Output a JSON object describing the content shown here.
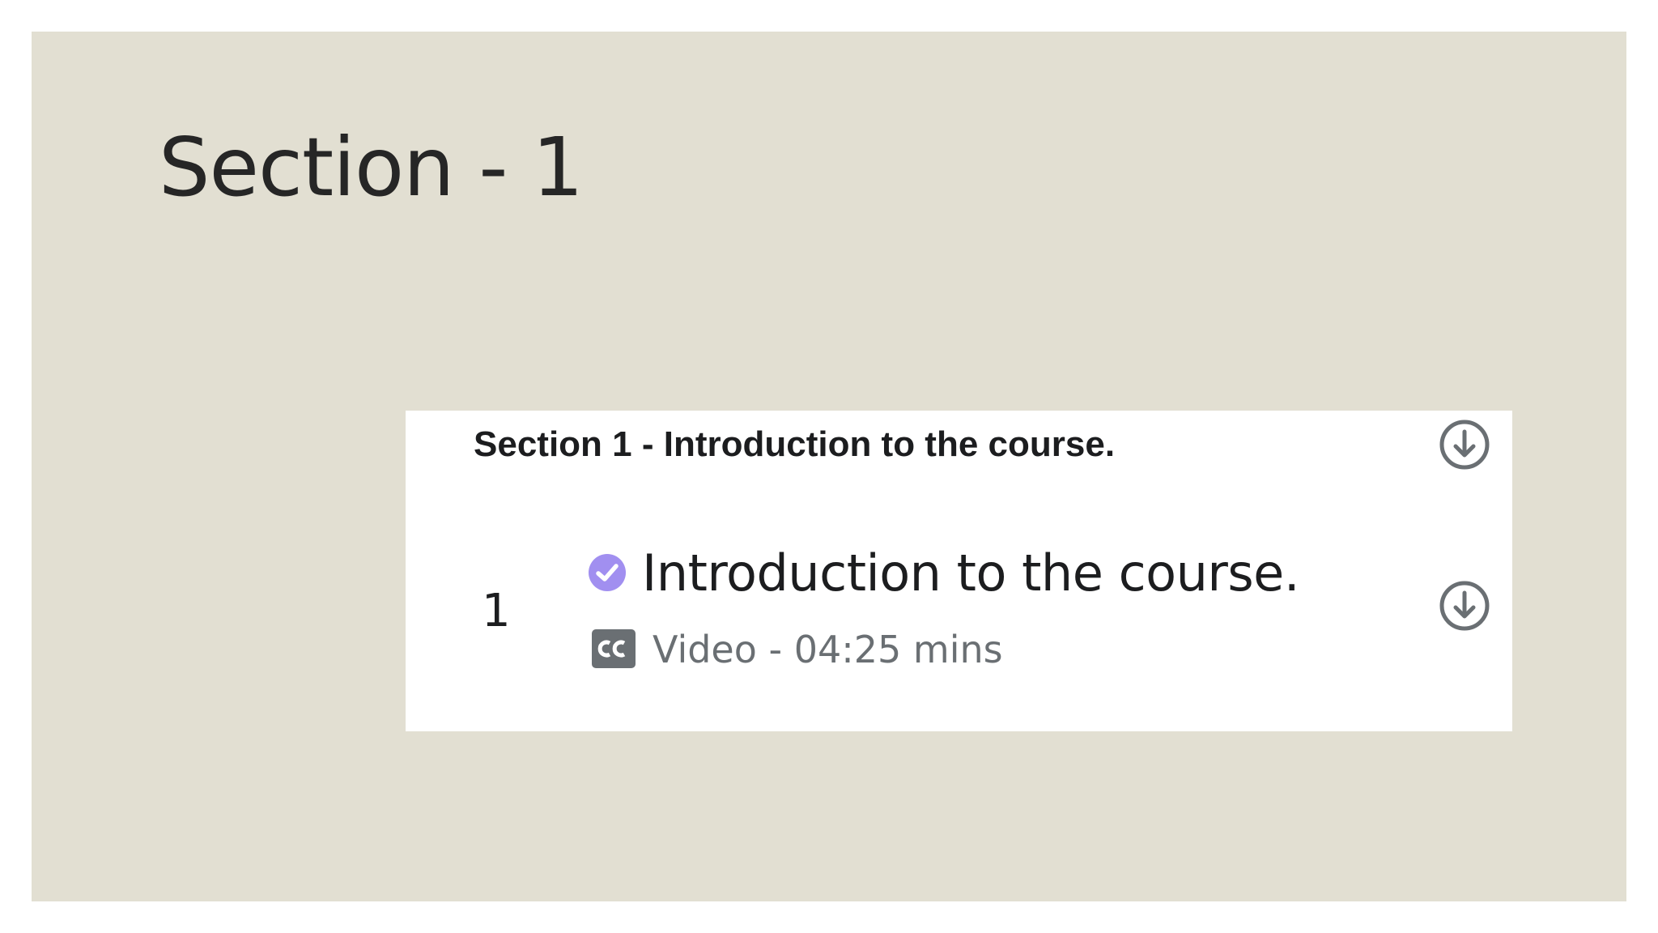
{
  "slide": {
    "title": "Section - 1",
    "background_color": "#e2dfd2"
  },
  "course_content": {
    "section_header": "Section 1 - Introduction to the course.",
    "header_action_icon": "download-circle-icon",
    "lectures": [
      {
        "number": "1",
        "status_icon": "check-circle-icon",
        "status_color": "#a18ff0",
        "title": "Introduction to the course.",
        "captions_icon": "closed-captions-icon",
        "meta": "Video - 04:25 mins",
        "action_icon": "download-circle-icon"
      }
    ]
  }
}
